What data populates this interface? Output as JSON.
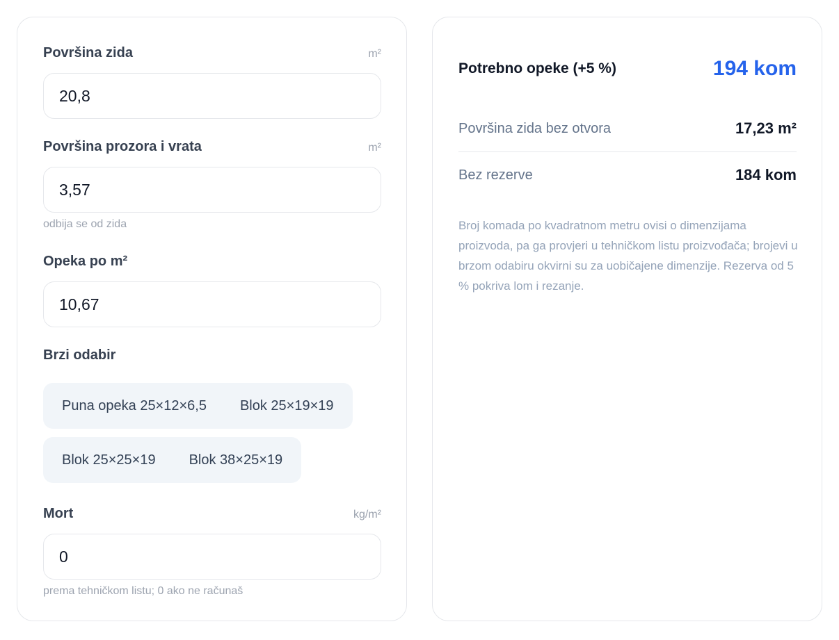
{
  "form": {
    "wall_area": {
      "label": "Površina zida",
      "unit": "m²",
      "value": "20,8"
    },
    "openings_area": {
      "label": "Površina prozora i vrata",
      "unit": "m²",
      "value": "3,57",
      "hint": "odbija se od zida"
    },
    "bricks_per_m2": {
      "label": "Opeka po m²",
      "value": "10,67"
    },
    "quick_select": {
      "label": "Brzi odabir",
      "options": [
        "Puna opeka 25×12×6,5",
        "Blok 25×19×19",
        "Blok 25×25×19",
        "Blok 38×25×19"
      ]
    },
    "mortar": {
      "label": "Mort",
      "unit": "kg/m²",
      "value": "0",
      "hint": "prema tehničkom listu; 0 ako ne računaš"
    }
  },
  "result": {
    "needed_label": "Potrebno opeke (+5 %)",
    "needed_value": "194 kom",
    "net_area_label": "Površina zida bez otvora",
    "net_area_value": "17,23 m²",
    "no_reserve_label": "Bez rezerve",
    "no_reserve_value": "184 kom",
    "note": "Broj komada po kvadratnom metru ovisi o dimenzijama proizvoda, pa ga provjeri u tehničkom listu proizvođača; brojevi u brzom odabiru okvirni su za uobičajene dimenzije. Rezerva od 5 % pokriva lom i rezanje."
  },
  "colors": {
    "accent": "#2563eb",
    "border": "#e5e7eb",
    "chip_bg": "#f1f5f9"
  }
}
